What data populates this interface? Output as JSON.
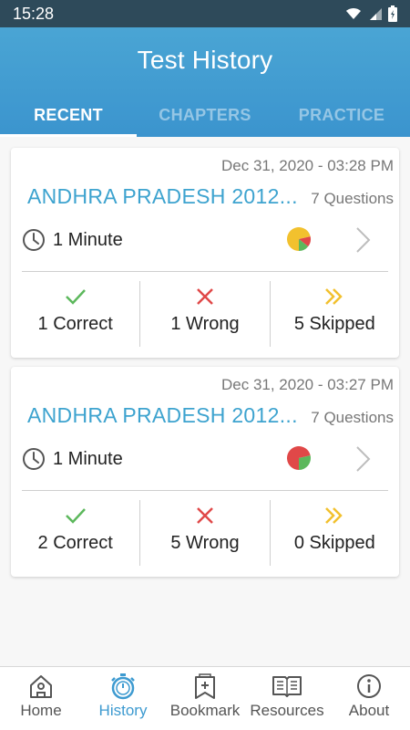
{
  "status_bar": {
    "time": "15:28"
  },
  "header": {
    "title": "Test History"
  },
  "tabs": [
    {
      "label": "RECENT",
      "active": true
    },
    {
      "label": "CHAPTERS",
      "active": false
    },
    {
      "label": "PRACTICE",
      "active": false
    }
  ],
  "cards": [
    {
      "date": "Dec 31, 2020 - 03:28 PM",
      "title": "ANDHRA PRADESH 2012...",
      "questions": "7 Questions",
      "duration": "1 Minute",
      "correct": "1 Correct",
      "wrong": "1 Wrong",
      "skipped": "5 Skipped",
      "pie": {
        "correct": 1,
        "wrong": 1,
        "skipped": 5
      }
    },
    {
      "date": "Dec 31, 2020 - 03:27 PM",
      "title": "ANDHRA PRADESH 2012...",
      "questions": "7 Questions",
      "duration": "1 Minute",
      "correct": "2 Correct",
      "wrong": "5 Wrong",
      "skipped": "0 Skipped",
      "pie": {
        "correct": 2,
        "wrong": 5,
        "skipped": 0
      }
    }
  ],
  "bottom_nav": [
    {
      "label": "Home",
      "icon": "home-icon",
      "active": false
    },
    {
      "label": "History",
      "icon": "stopwatch-icon",
      "active": true
    },
    {
      "label": "Bookmark",
      "icon": "bookmark-icon",
      "active": false
    },
    {
      "label": "Resources",
      "icon": "book-icon",
      "active": false
    },
    {
      "label": "About",
      "icon": "info-icon",
      "active": false
    }
  ],
  "colors": {
    "accent": "#3d9ad0",
    "title_link": "#3da3cf",
    "correct": "#5cb85c",
    "wrong": "#e04848",
    "skipped": "#f2c12e"
  }
}
